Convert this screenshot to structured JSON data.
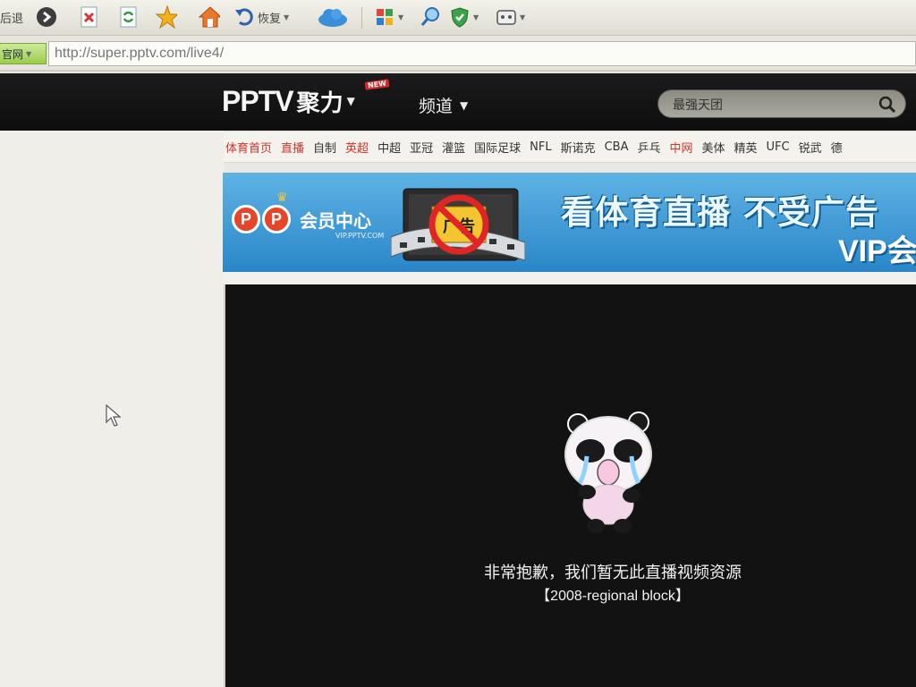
{
  "toolbar": {
    "back_label": "后退",
    "restore_label": "恢复",
    "icons": [
      "forward-icon",
      "close-page-icon",
      "refresh-icon",
      "favorite-star-icon",
      "home-icon",
      "restore-icon",
      "cloud-icon",
      "apps-icon",
      "search-magnifier-icon",
      "shield-icon",
      "game-icon"
    ]
  },
  "address": {
    "site_tag": "官网",
    "url": "http://super.pptv.com/live4/"
  },
  "header": {
    "logo_text": "PPTV",
    "logo_suffix": "聚力",
    "new_badge": "NEW",
    "channel_label": "频道",
    "search_value": "最强天团"
  },
  "sport_nav": {
    "items": [
      {
        "label": "体育首页",
        "red": true
      },
      {
        "label": "直播",
        "red": true
      },
      {
        "label": "自制",
        "red": false
      },
      {
        "label": "英超",
        "red": true
      },
      {
        "label": "中超",
        "red": false
      },
      {
        "label": "亚冠",
        "red": false
      },
      {
        "label": "灌篮",
        "red": false
      },
      {
        "label": "国际足球",
        "red": false
      },
      {
        "label": "NFL",
        "red": false
      },
      {
        "label": "斯诺克",
        "red": false
      },
      {
        "label": "CBA",
        "red": false
      },
      {
        "label": "乒乓",
        "red": false
      },
      {
        "label": "中网",
        "red": true
      },
      {
        "label": "美体",
        "red": false
      },
      {
        "label": "精英",
        "red": false
      },
      {
        "label": "UFC",
        "red": false
      },
      {
        "label": "锐武",
        "red": false
      },
      {
        "label": "德",
        "red": false
      }
    ]
  },
  "banner": {
    "pp": "PP",
    "member_center": "会员中心",
    "site": "VIP.PPTV.COM",
    "ad_text": "广告",
    "slogan": "看体育直播 不受广告",
    "vip": "VIP会"
  },
  "player": {
    "message": "非常抱歉，我们暂无此直播视频资源",
    "code": "【2008-regional block】"
  },
  "colors": {
    "header_bg": "#111111",
    "nav_red": "#d0342c",
    "banner_blue": "#3b9ad6",
    "player_bg": "#121212"
  }
}
